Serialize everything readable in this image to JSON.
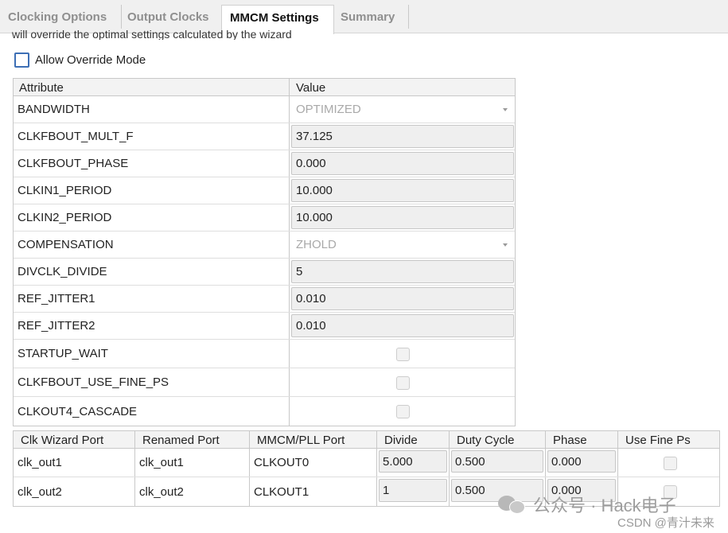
{
  "tabs": [
    {
      "label": "Clocking Options",
      "active": false
    },
    {
      "label": "Output Clocks",
      "active": false
    },
    {
      "label": "MMCM Settings",
      "active": true
    },
    {
      "label": "Summary",
      "active": false
    }
  ],
  "description_partial": "will override the optimal settings calculated by the wizard",
  "override": {
    "label": "Allow Override Mode",
    "checked": false
  },
  "attr_table": {
    "col_attribute": "Attribute",
    "col_value": "Value",
    "rows": [
      {
        "name": "BANDWIDTH",
        "value": "OPTIMIZED"
      },
      {
        "name": "CLKFBOUT_MULT_F",
        "value": "37.125"
      },
      {
        "name": "CLKFBOUT_PHASE",
        "value": "0.000"
      },
      {
        "name": "CLKIN1_PERIOD",
        "value": "10.000"
      },
      {
        "name": "CLKIN2_PERIOD",
        "value": "10.000"
      },
      {
        "name": "COMPENSATION",
        "value": "ZHOLD"
      },
      {
        "name": "DIVCLK_DIVIDE",
        "value": "5"
      },
      {
        "name": "REF_JITTER1",
        "value": "0.010"
      },
      {
        "name": "REF_JITTER2",
        "value": "0.010"
      },
      {
        "name": "STARTUP_WAIT",
        "value": ""
      },
      {
        "name": "CLKFBOUT_USE_FINE_PS",
        "value": ""
      },
      {
        "name": "CLKOUT4_CASCADE",
        "value": ""
      }
    ]
  },
  "port_table": {
    "headers": [
      "Clk Wizard Port",
      "Renamed Port",
      "MMCM/PLL Port",
      "Divide",
      "Duty Cycle",
      "Phase",
      "Use Fine Ps"
    ],
    "rows": [
      {
        "wizard_port": "clk_out1",
        "renamed_port": "clk_out1",
        "pll_port": "CLKOUT0",
        "divide": "5.000",
        "duty_cycle": "0.500",
        "phase": "0.000"
      },
      {
        "wizard_port": "clk_out2",
        "renamed_port": "clk_out2",
        "pll_port": "CLKOUT1",
        "divide": "1",
        "duty_cycle": "0.500",
        "phase": "0.000"
      }
    ]
  },
  "watermark": {
    "line1": "公众号 · Hack电子",
    "line2": "CSDN @青汁未来"
  },
  "colors": {
    "checkbox_border": "#3d6fb5",
    "tab_inactive_text": "#8f8f8f",
    "input_bg": "#efefef"
  }
}
